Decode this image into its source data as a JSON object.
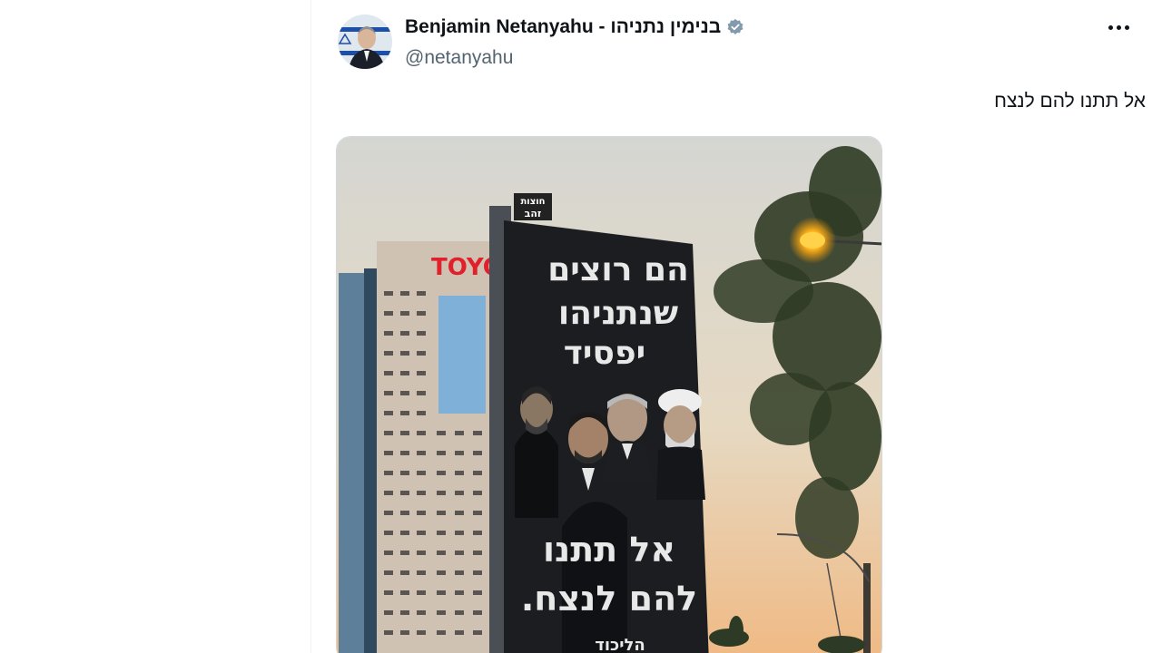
{
  "author": {
    "display_name": "Benjamin Netanyahu - בנימין נתניהו",
    "handle": "@netanyahu"
  },
  "tweet": {
    "text": "אל תתנו להם לנצח"
  },
  "media": {
    "building_sign": "TOYO",
    "rooftop_sign_line1": "חוצות",
    "rooftop_sign_line2": "זהב",
    "billboard_headline_line1": "הם רוצים",
    "billboard_headline_line2": "שנתניהו",
    "billboard_headline_line3": "יפסיד",
    "billboard_slogan_line1": "אל תתנו",
    "billboard_slogan_line2": "להם לנצח.",
    "billboard_logo": "הליכוד"
  },
  "icons": {
    "verified": "verified-badge-icon",
    "more": "more-options-icon"
  },
  "colors": {
    "verified": "#829aab",
    "text_primary": "#0f1419",
    "text_secondary": "#536471",
    "sign_red": "#e0202a"
  }
}
